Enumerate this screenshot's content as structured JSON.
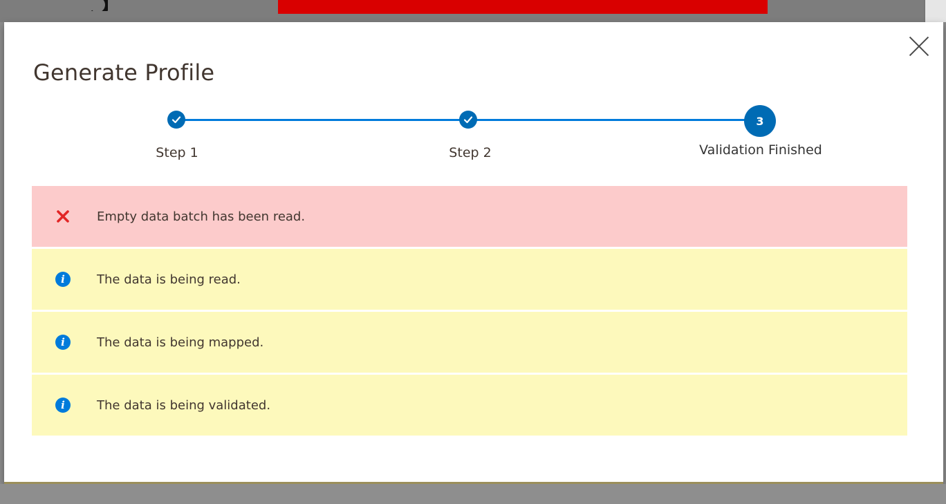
{
  "modal": {
    "title": "Generate Profile"
  },
  "steps": [
    {
      "label": "Step 1",
      "state": "complete"
    },
    {
      "label": "Step 2",
      "state": "complete"
    },
    {
      "label": "Validation Finished",
      "state": "current",
      "number": "3"
    }
  ],
  "messages": [
    {
      "type": "error",
      "icon": "close-x-icon",
      "text": "Empty data batch has been read."
    },
    {
      "type": "info",
      "icon": "info-icon",
      "text": "The data is being read."
    },
    {
      "type": "info",
      "icon": "info-icon",
      "text": "The data is being mapped."
    },
    {
      "type": "info",
      "icon": "info-icon",
      "text": "The data is being validated."
    }
  ],
  "colors": {
    "accent": "#006bb4",
    "step_line": "#007bdb",
    "error_bg": "#fccbcb",
    "info_bg": "#fdf9bc",
    "error_icon": "#e22626",
    "banner": "#d90000"
  }
}
